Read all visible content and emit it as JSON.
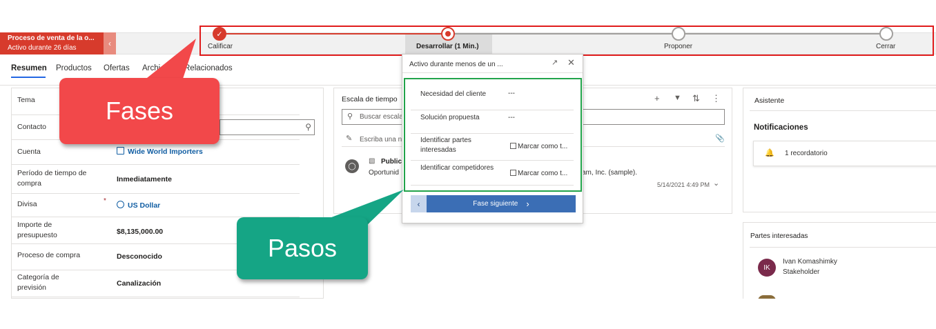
{
  "bpf": {
    "process_name": "Proceso de venta de la o...",
    "active_duration": "Activo durante 26 días",
    "stages": [
      {
        "label": "Calificar",
        "state": "done"
      },
      {
        "label": "Desarrollar  (1 Min.)",
        "state": "active"
      },
      {
        "label": "Proponer",
        "state": "pending"
      },
      {
        "label": "Cerrar",
        "state": "pending"
      }
    ],
    "accent_color": "#d73b2c"
  },
  "tabs": [
    "Resumen",
    "Productos",
    "Ofertas",
    "Archi",
    "Relacionados"
  ],
  "form": {
    "fields": [
      {
        "label": "Tema",
        "value": ""
      },
      {
        "label": "Contacto",
        "value": ""
      },
      {
        "label": "Cuenta",
        "value": "Wide World Importers"
      },
      {
        "label": "Período de tiempo de compra",
        "value": "Inmediatamente"
      },
      {
        "label": "Divisa",
        "required": "*",
        "value": "US Dollar"
      },
      {
        "label": "Importe de presupuesto",
        "value": "$8,135,000.00"
      },
      {
        "label": "Proceso de compra",
        "value": "Desconocido"
      },
      {
        "label": "Categoría de previsión",
        "value": "Canalización"
      }
    ]
  },
  "timeline": {
    "title": "Escala de tiempo",
    "search_placeholder": "Buscar escala",
    "note_placeholder": "Escriba una n",
    "post_title": "Publica",
    "post_body_start": "Oportunid",
    "post_body_end": "am, Inc. (sample).",
    "post_date": "5/14/2021 4:49 PM"
  },
  "flyout": {
    "header": "Activo durante menos de un ...",
    "steps": [
      {
        "label": "Necesidad del cliente",
        "value": "---"
      },
      {
        "label": "Solución propuesta",
        "value": "---"
      },
      {
        "label": "Identificar partes interesadas",
        "value": "Marcar como t..."
      },
      {
        "label": "Identificar competidores",
        "value": "Marcar como t..."
      }
    ],
    "next_label": "Fase siguiente"
  },
  "assistant": {
    "title": "Asistente",
    "notifications_title": "Notificaciones",
    "reminder": "1 recordatorio"
  },
  "stakeholders": {
    "title": "Partes interesadas",
    "items": [
      {
        "initials": "IK",
        "name": "Ivan Komashimky",
        "role": "Stakeholder",
        "color": "#7a2a4b"
      }
    ]
  },
  "callouts": {
    "phases": "Fases",
    "steps": "Pasos",
    "phases_color": "#f2484a",
    "steps_color": "#15a585"
  }
}
